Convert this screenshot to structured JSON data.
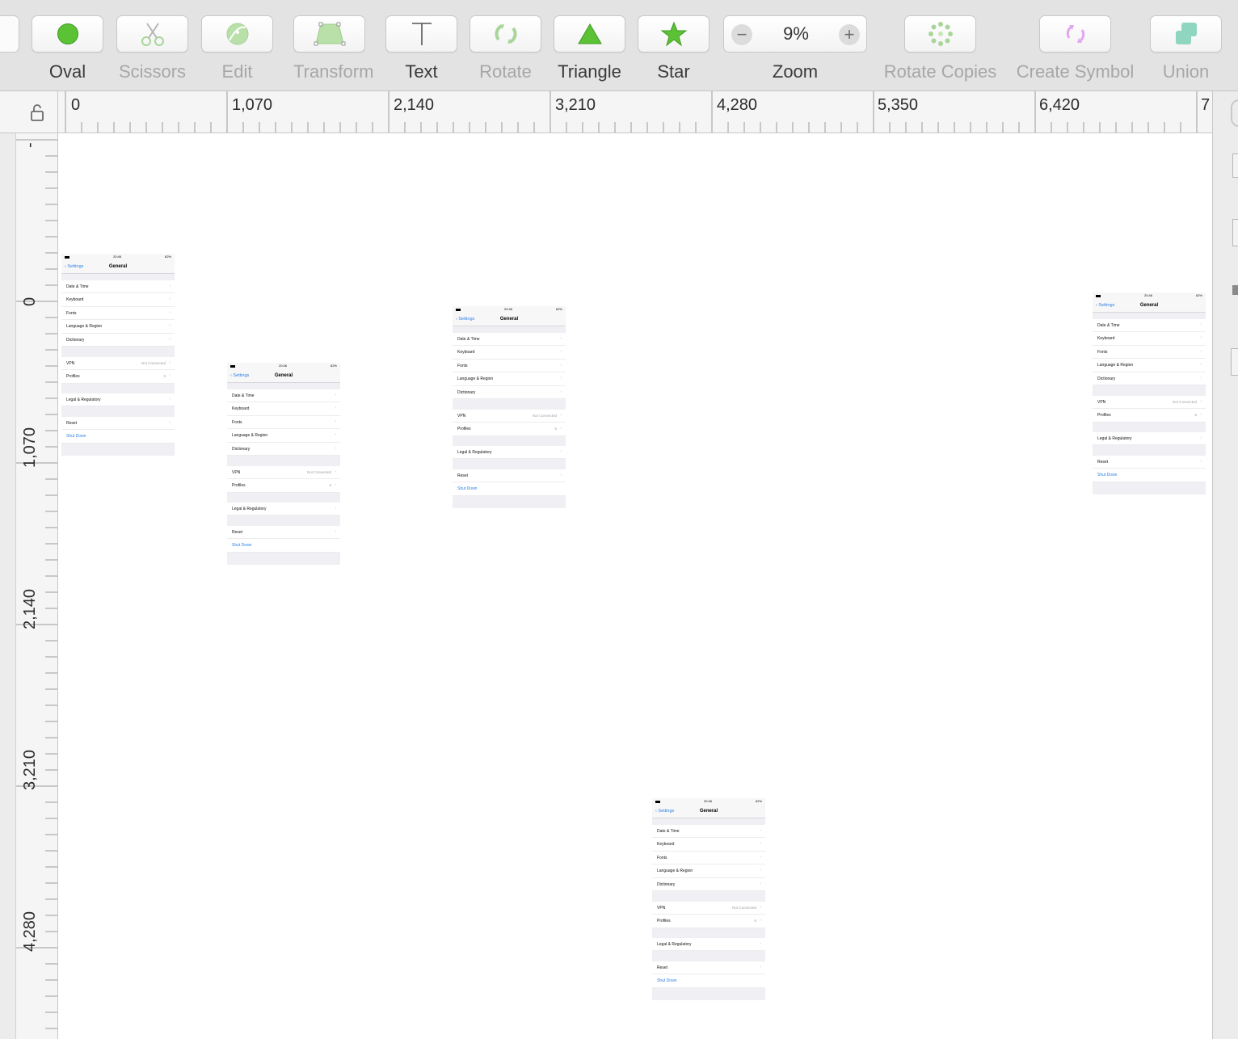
{
  "toolbar": {
    "tools": [
      {
        "name": "oval",
        "label": "Oval",
        "icon": "green-circle-icon",
        "active": true
      },
      {
        "name": "scissors",
        "label": "Scissors",
        "icon": "scissors-icon",
        "active": false
      },
      {
        "name": "edit",
        "label": "Edit",
        "icon": "edit-shape-icon",
        "active": false
      },
      {
        "name": "transform",
        "label": "Transform",
        "icon": "transform-icon",
        "active": false
      },
      {
        "name": "text",
        "label": "Text",
        "icon": "text-icon",
        "active": true
      },
      {
        "name": "rotate",
        "label": "Rotate",
        "icon": "rotate-icon",
        "active": false
      },
      {
        "name": "triangle",
        "label": "Triangle",
        "icon": "triangle-icon",
        "active": true
      },
      {
        "name": "star",
        "label": "Star",
        "icon": "star-icon",
        "active": true
      },
      {
        "name": "rotate-copies",
        "label": "Rotate Copies",
        "icon": "rotate-copies-icon",
        "active": false
      },
      {
        "name": "create-symbol",
        "label": "Create Symbol",
        "icon": "create-symbol-icon",
        "active": false
      },
      {
        "name": "union",
        "label": "Union",
        "icon": "union-icon",
        "active": false
      }
    ],
    "zoom": {
      "value": "9%",
      "label": "Zoom",
      "minus": "−",
      "plus": "+"
    }
  },
  "rulers": {
    "horizontal": [
      "0",
      "1,070",
      "2,140",
      "3,210",
      "4,280",
      "5,350",
      "6,420",
      "7"
    ],
    "vertical": [
      "-",
      "0",
      "1,070",
      "2,140",
      "3,210",
      "4,280"
    ]
  },
  "artboard": {
    "status_time": "20:46",
    "status_battery": "62%",
    "back_label": "Settings",
    "title": "General",
    "group1": [
      "Date & Time",
      "Keyboard",
      "Fonts",
      "Language & Region",
      "Dictionary"
    ],
    "vpn_label": "VPN",
    "vpn_value": "Not Connected",
    "profiles_label": "Profiles",
    "profiles_value": "6",
    "legal": "Legal & Regulatory",
    "reset": "Reset",
    "shutdown": "Shut Down"
  },
  "colors": {
    "accent_green": "#5bc236",
    "ios_blue": "#2f7fe4",
    "toolbar_bg": "#e3e3e3"
  }
}
